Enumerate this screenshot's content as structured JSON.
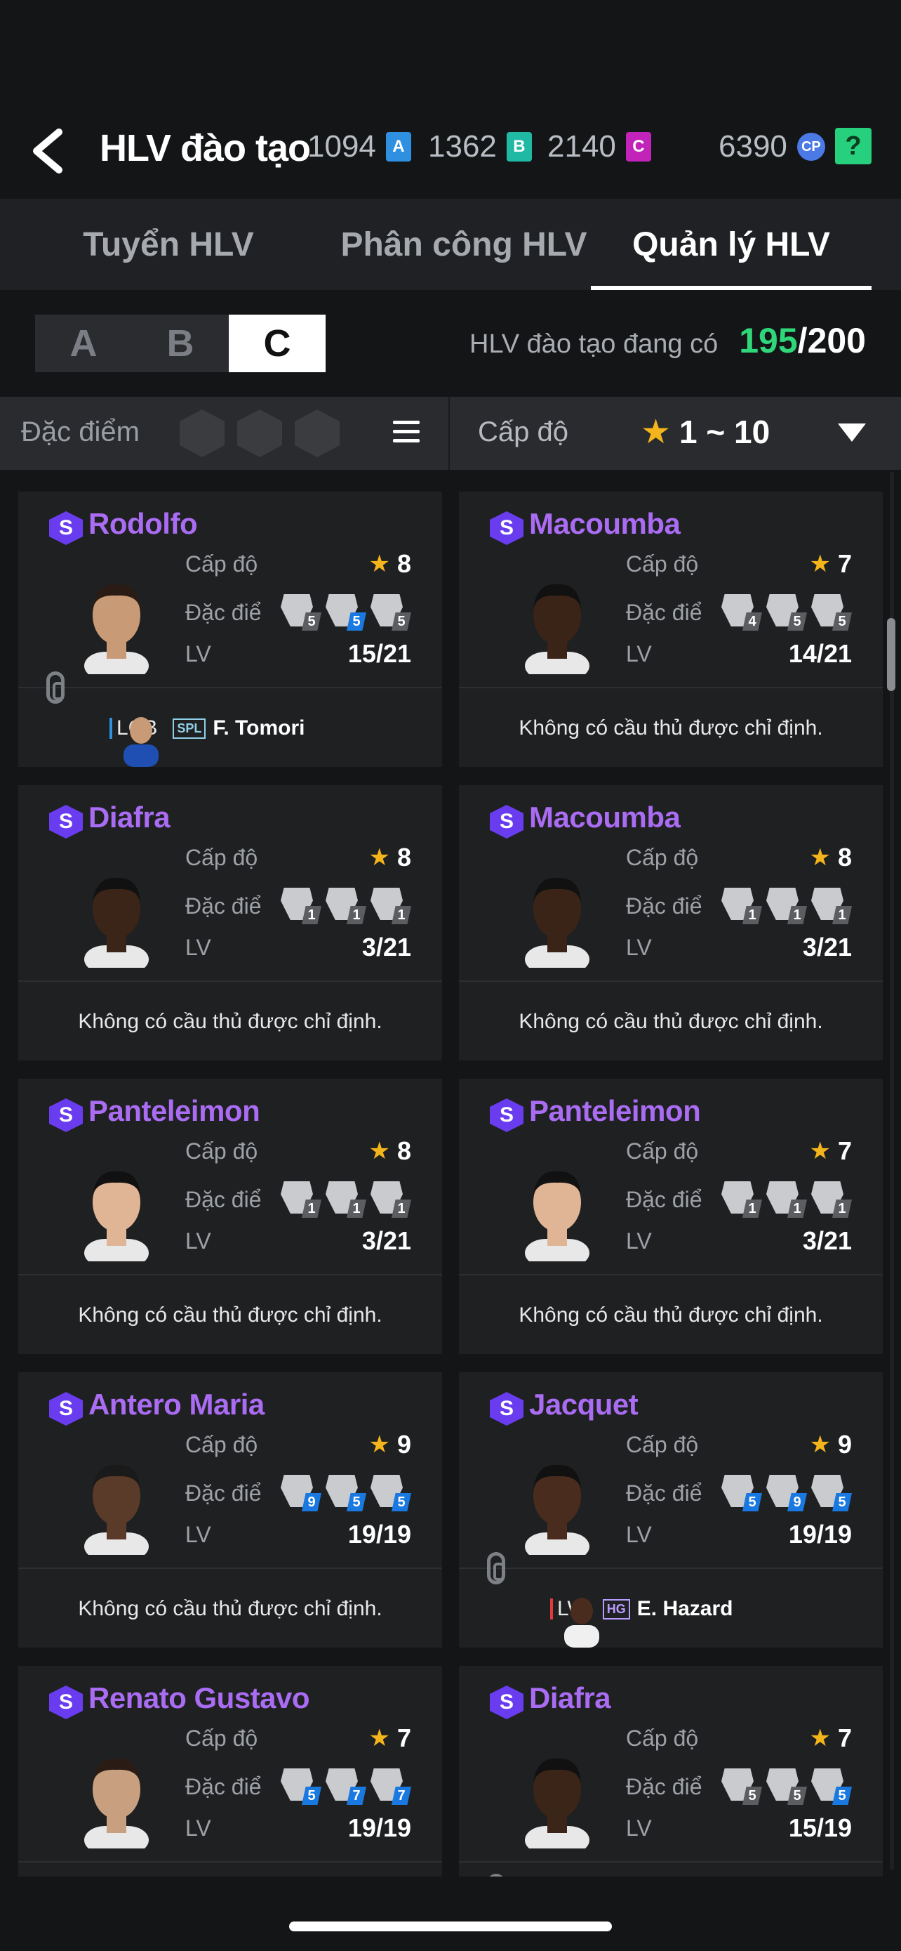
{
  "header": {
    "title": "HLV đào tạo",
    "currency_a": "1094",
    "currency_a_icon": "A",
    "currency_b": "1362",
    "currency_b_icon": "B",
    "currency_c": "2140",
    "currency_c_icon": "C",
    "cp": "6390",
    "cp_icon": "CP",
    "help": "?"
  },
  "tabs": [
    {
      "label": "Tuyển HLV",
      "active": false
    },
    {
      "label": "Phân công HLV",
      "active": false
    },
    {
      "label": "Quản lý HLV",
      "active": true
    }
  ],
  "groups": [
    "A",
    "B",
    "C"
  ],
  "selected_group": "C",
  "coach_count": {
    "label": "HLV đào tạo đang có",
    "current": "195",
    "max": "/200"
  },
  "filters": {
    "trait_label": "Đặc điểm c",
    "level_label": "Cấp độ",
    "level_range": "1 ~ 10"
  },
  "labels": {
    "level": "Cấp độ",
    "trait": "Đặc điểm",
    "lv": "LV",
    "no_player": "Không có cầu thủ được chỉ định."
  },
  "cards": [
    {
      "name": "Rodolfo",
      "level": "8",
      "lv": "15/21",
      "traits": [
        5,
        5,
        5
      ],
      "trait_colors": [
        "g",
        "b",
        "g"
      ],
      "player": {
        "pos": "LCB",
        "season": "SPL",
        "name": "F. Tomori"
      }
    },
    {
      "name": "Macoumba",
      "level": "7",
      "lv": "14/21",
      "traits": [
        4,
        5,
        5
      ],
      "trait_colors": [
        "g",
        "g",
        "g"
      ],
      "player": null
    },
    {
      "name": "Diafra",
      "level": "8",
      "lv": "3/21",
      "traits": [
        1,
        1,
        1
      ],
      "trait_colors": [
        "g",
        "g",
        "g"
      ],
      "player": null
    },
    {
      "name": "Macoumba",
      "level": "8",
      "lv": "3/21",
      "traits": [
        1,
        1,
        1
      ],
      "trait_colors": [
        "g",
        "g",
        "g"
      ],
      "player": null
    },
    {
      "name": "Panteleimon",
      "level": "8",
      "lv": "3/21",
      "traits": [
        1,
        1,
        1
      ],
      "trait_colors": [
        "g",
        "g",
        "g"
      ],
      "player": null
    },
    {
      "name": "Panteleimon",
      "level": "7",
      "lv": "3/21",
      "traits": [
        1,
        1,
        1
      ],
      "trait_colors": [
        "g",
        "g",
        "g"
      ],
      "player": null
    },
    {
      "name": "Antero Maria",
      "level": "9",
      "lv": "19/19",
      "traits": [
        9,
        5,
        5
      ],
      "trait_colors": [
        "b",
        "b",
        "b"
      ],
      "player": null
    },
    {
      "name": "Jacquet",
      "level": "9",
      "lv": "19/19",
      "traits": [
        5,
        9,
        5
      ],
      "trait_colors": [
        "b",
        "b",
        "b"
      ],
      "player": {
        "pos": "LW",
        "season": "HG",
        "name": "E. Hazard"
      }
    },
    {
      "name": "Renato Gustavo",
      "level": "7",
      "lv": "19/19",
      "traits": [
        5,
        7,
        7
      ],
      "trait_colors": [
        "b",
        "b",
        "b"
      ],
      "player": null
    },
    {
      "name": "Diafra",
      "level": "7",
      "lv": "15/19",
      "traits": [
        5,
        5,
        5
      ],
      "trait_colors": [
        "g",
        "g",
        "b"
      ],
      "player": null
    }
  ],
  "colors": {
    "accent_purple": "#a96cf2",
    "count_green": "#2fd67a",
    "star": "#f4b51c",
    "trait_blue": "#1a79e0"
  }
}
